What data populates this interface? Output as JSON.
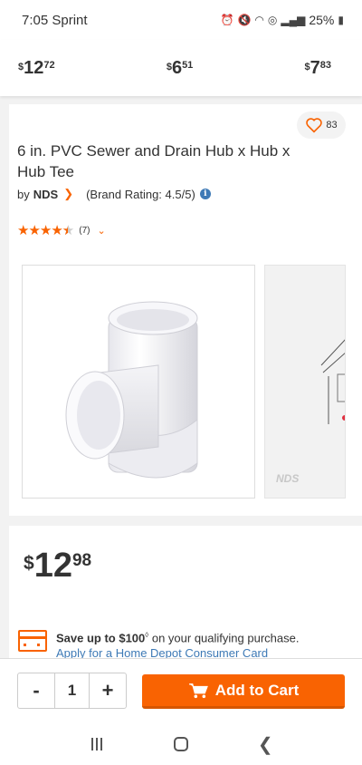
{
  "status_bar": {
    "time": "7:05 Sprint",
    "icons": [
      "alarm-icon",
      "mute-icon",
      "wifi-icon",
      "hotspot-icon",
      "signal-icon"
    ],
    "battery": "25%"
  },
  "price_strip": [
    {
      "currency": "$",
      "dollars": "12",
      "cents": "72"
    },
    {
      "currency": "$",
      "dollars": "6",
      "cents": "51"
    },
    {
      "currency": "$",
      "dollars": "7",
      "cents": "83"
    }
  ],
  "product": {
    "favorite_count": "83",
    "title": "6 in. PVC Sewer and Drain Hub x Hub x Hub Tee",
    "by": "by",
    "brand": "NDS",
    "brand_rating": "(Brand Rating: 4.5/5)",
    "rating_stars": 4.5,
    "review_count": "(7)",
    "second_image_logo": "NDS"
  },
  "pricing": {
    "currency": "$",
    "dollars": "12",
    "cents": "98",
    "promo_bold": "Save up to $100",
    "promo_sup": "◊",
    "promo_rest": " on your qualifying purchase.",
    "promo_link": "Apply for a Home Depot Consumer Card"
  },
  "cart": {
    "minus": "-",
    "quantity": "1",
    "plus": "+",
    "add_label": "Add to Cart"
  },
  "colors": {
    "accent": "#f96302",
    "link": "#3e7ab6"
  }
}
